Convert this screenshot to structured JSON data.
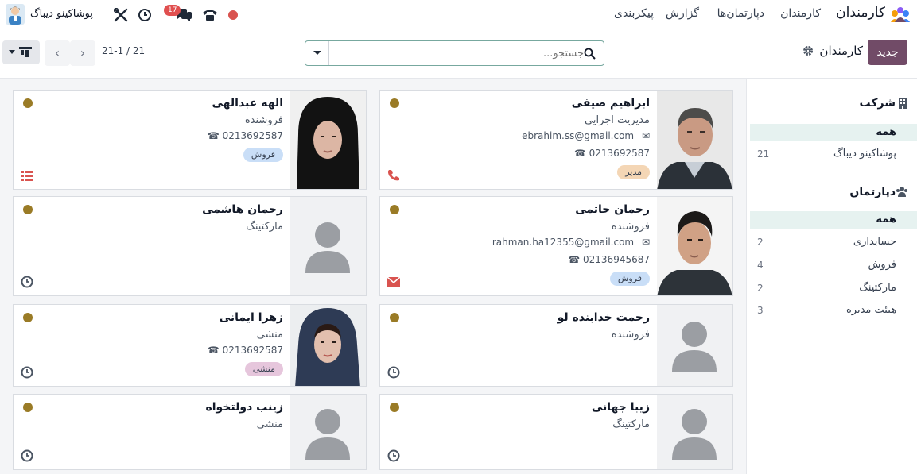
{
  "navbar": {
    "app_title": "کارمندان",
    "menu": [
      "کارمندان",
      "دپارتمان‌ها",
      "گزارش",
      "پیکربندی"
    ],
    "company_name": "پوشاکینو دیباگ",
    "chat_badge": "17",
    "icons": [
      "record-icon",
      "phone-icon",
      "chat-icon",
      "clock-icon",
      "tools-icon"
    ]
  },
  "control_panel": {
    "new_button": "جدید",
    "breadcrumb": "کارمندان",
    "search_placeholder": "جستجو...",
    "pager": "21 / 21-1"
  },
  "cards": [
    {
      "name": "ابراهیم صیفی",
      "job": "مدیریت اجرایی",
      "email": "ebrahim.ss@gmail.com",
      "phone": "0213692587",
      "tag": "مدیر",
      "tag_color": "#f4d6b5",
      "bottom_icon": "phone-icon",
      "status_color": "#9a7b26"
    },
    {
      "name": "الهه عبدالهی",
      "job": "فروشنده",
      "phone": "0213692587",
      "tag": "فروش",
      "tag_color": "#c9def7",
      "bottom_icon": "list-icon",
      "status_color": "#9a7b26"
    },
    {
      "name": "رحمان حاتمی",
      "job": "فروشنده",
      "email": "rahman.ha12355@gmail.com",
      "phone": "02136945687",
      "tag": "فروش",
      "tag_color": "#c9def7",
      "bottom_icon": "envelope-icon",
      "status_color": "#9a7b26"
    },
    {
      "name": "رحمان هاشمی",
      "job": "مارکتینگ",
      "bottom_icon": "clock-icon",
      "status_color": "#9a7b26"
    },
    {
      "name": "رحمت خدابنده لو",
      "job": "فروشنده",
      "bottom_icon": "clock-icon",
      "status_color": "#9a7b26"
    },
    {
      "name": "زهرا ایمانی",
      "job": "منشی",
      "phone": "0213692587",
      "tag": "منشی",
      "tag_color": "#e6c6dc",
      "bottom_icon": "clock-icon",
      "status_color": "#9a7b26"
    },
    {
      "name": "زیبا جهانی",
      "job": "مارکتینگ",
      "bottom_icon": "clock-icon",
      "status_color": "#9a7b26"
    },
    {
      "name": "زینب دولتخواه",
      "job": "منشی",
      "bottom_icon": "clock-icon",
      "status_color": "#9a7b26"
    }
  ],
  "sidebar": {
    "company_header": "شرکت",
    "company_items": [
      {
        "label": "همه",
        "count": ""
      },
      {
        "label": "پوشاکینو دیباگ",
        "count": "21"
      }
    ],
    "department_header": "دپارتمان",
    "department_items": [
      {
        "label": "همه",
        "count": ""
      },
      {
        "label": "حسابداری",
        "count": "2"
      },
      {
        "label": "فروش",
        "count": "4"
      },
      {
        "label": "مارکتینگ",
        "count": "2"
      },
      {
        "label": "هیئت مدیره",
        "count": "3"
      }
    ]
  },
  "colors": {
    "brand": "#714b67",
    "accent": "#017e84",
    "status": "#9a7b26"
  }
}
